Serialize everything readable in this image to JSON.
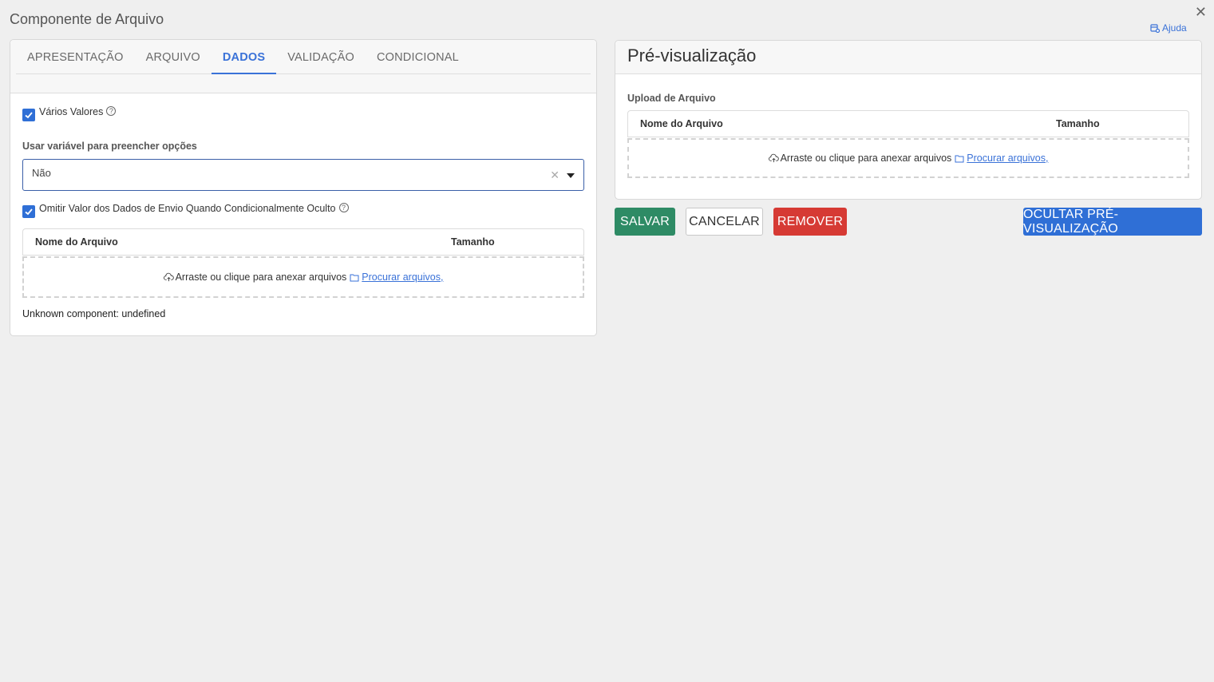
{
  "modal": {
    "title": "Componente de Arquivo",
    "help_label": "Ajuda"
  },
  "tabs": [
    {
      "label": "APRESENTAÇÃO"
    },
    {
      "label": "ARQUIVO"
    },
    {
      "label": "DADOS"
    },
    {
      "label": "VALIDAÇÃO"
    },
    {
      "label": "CONDICIONAL"
    }
  ],
  "active_tab": "DADOS",
  "data_tab": {
    "multiple_values": {
      "label": "Vários Valores",
      "checked": true
    },
    "use_variable": {
      "label": "Usar variável para preencher opções",
      "value": "Não"
    },
    "omit_value": {
      "label": "Omitir Valor dos Dados de Envio Quando Condicionalmente Oculto",
      "checked": true
    },
    "file_table": {
      "col_name": "Nome do Arquivo",
      "col_size": "Tamanho",
      "drop_text": "Arraste ou clique para anexar arquivos",
      "browse_link": "Procurar arquivos,"
    },
    "unknown_component": "Unknown component: undefined"
  },
  "preview": {
    "title": "Pré-visualização",
    "upload_label": "Upload de Arquivo",
    "file_table": {
      "col_name": "Nome do Arquivo",
      "col_size": "Tamanho",
      "drop_text": "Arraste ou clique para anexar arquivos",
      "browse_link": "Procurar arquivos,"
    }
  },
  "buttons": {
    "save": "SALVAR",
    "cancel": "CANCELAR",
    "remove": "REMOVER",
    "hide_preview": "OCULTAR PRÉ-VISUALIZAÇÃO"
  },
  "colors": {
    "accent": "#3a72d8",
    "save": "#2e8b65",
    "remove": "#d63a34",
    "primary": "#2f6fd6"
  }
}
